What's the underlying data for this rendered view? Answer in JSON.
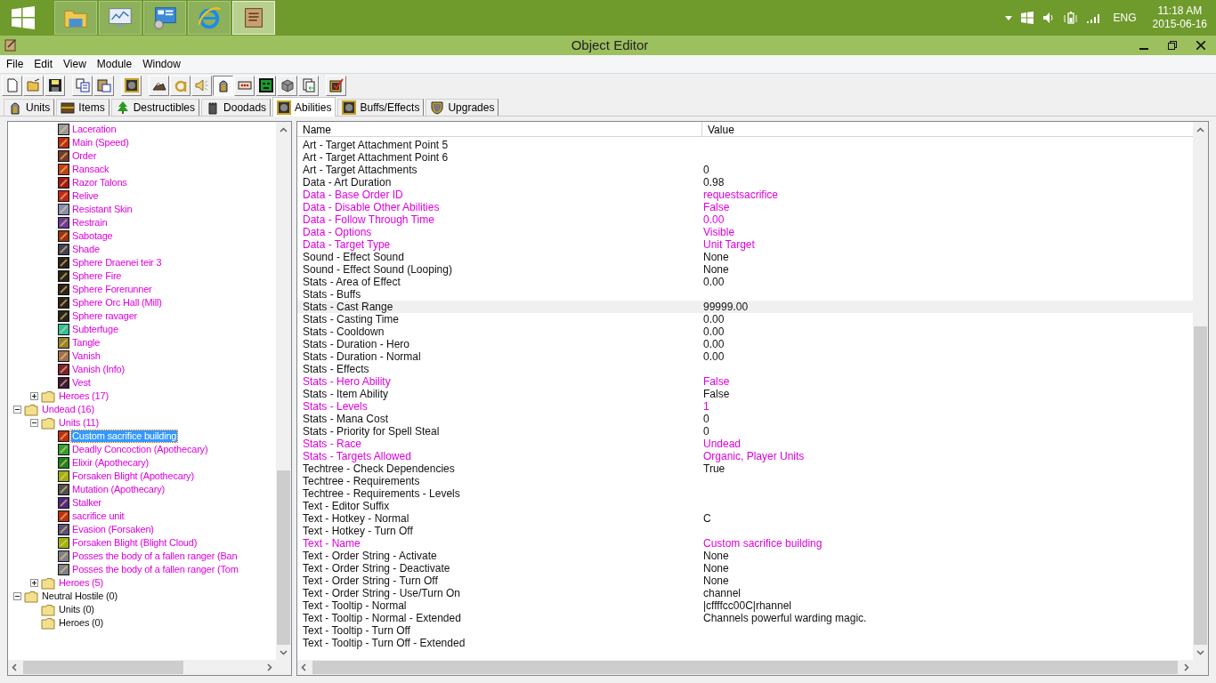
{
  "taskbar": {
    "apps": [
      {
        "kind": "folder",
        "selected": false
      },
      {
        "kind": "monitor",
        "selected": false
      },
      {
        "kind": "panel",
        "selected": false
      },
      {
        "kind": "browser",
        "selected": false
      },
      {
        "kind": "scroll",
        "selected": true
      }
    ],
    "language": "ENG",
    "time": "11:18 AM",
    "date": "2015-06-16"
  },
  "window": {
    "title": "Object Editor"
  },
  "menu": [
    "File",
    "Edit",
    "View",
    "Module",
    "Window"
  ],
  "toolbar": [
    {
      "kind": "new",
      "pressed": false
    },
    {
      "kind": "open",
      "pressed": false
    },
    {
      "kind": "save",
      "pressed": false
    },
    {
      "kind": "copy",
      "pressed": false
    },
    {
      "kind": "paste",
      "pressed": false
    },
    {
      "kind": "fist",
      "pressed": false
    },
    {
      "kind": "terrain",
      "pressed": false
    },
    {
      "kind": "letter",
      "pressed": false
    },
    {
      "kind": "sound",
      "pressed": false
    },
    {
      "kind": "helmet",
      "pressed": true
    },
    {
      "kind": "dice",
      "pressed": false
    },
    {
      "kind": "mask",
      "pressed": false
    },
    {
      "kind": "cube",
      "pressed": false
    },
    {
      "kind": "import",
      "pressed": false
    },
    {
      "kind": "check",
      "pressed": false
    }
  ],
  "tabs": [
    {
      "label": "Units",
      "kind": "helmet",
      "selected": false
    },
    {
      "label": "Items",
      "kind": "chest",
      "selected": false
    },
    {
      "label": "Destructibles",
      "kind": "tree",
      "selected": false
    },
    {
      "label": "Doodads",
      "kind": "tower",
      "selected": false
    },
    {
      "label": "Abilities",
      "kind": "fist",
      "selected": true
    },
    {
      "label": "Buffs/Effects",
      "kind": "fist",
      "selected": false
    },
    {
      "label": "Upgrades",
      "kind": "shield",
      "selected": false
    }
  ],
  "tree": [
    {
      "children": [
        {
          "children": [
            {
              "label": "Laceration",
              "color": "#9a9aa0",
              "modified": true,
              "selected": false
            },
            {
              "label": "Main (Speed)",
              "color": "#b83010",
              "modified": true,
              "selected": false
            },
            {
              "label": "Order",
              "color": "#7a3a28",
              "modified": true,
              "selected": false
            },
            {
              "label": "Ransack",
              "color": "#c04010",
              "modified": true,
              "selected": false
            },
            {
              "label": "Razor Talons",
              "color": "#a01818",
              "modified": true,
              "selected": false
            },
            {
              "label": "Relive",
              "color": "#c02818",
              "modified": true,
              "selected": false
            },
            {
              "label": "Resistant Skin",
              "color": "#8890b0",
              "modified": true,
              "selected": false
            },
            {
              "label": "Restrain",
              "color": "#6a3a98",
              "modified": true,
              "selected": false
            },
            {
              "label": "Sabotage",
              "color": "#a03010",
              "modified": true,
              "selected": false
            },
            {
              "label": "Shade",
              "color": "#404058",
              "modified": true,
              "selected": false
            },
            {
              "label": "Sphere Draenei teir 3",
              "color": "#2a2418",
              "modified": true,
              "selected": false
            },
            {
              "label": "Sphere Fire",
              "color": "#2a2418",
              "modified": true,
              "selected": false
            },
            {
              "label": "Sphere Forerunner",
              "color": "#2a2418",
              "modified": true,
              "selected": false
            },
            {
              "label": "Sphere Orc Hall (Mill)",
              "color": "#2a2418",
              "modified": true,
              "selected": false
            },
            {
              "label": "Sphere ravager",
              "color": "#2a2418",
              "modified": true,
              "selected": false
            },
            {
              "label": "Subterfuge",
              "color": "#30c0a0",
              "modified": true,
              "selected": false
            },
            {
              "label": "Tangle",
              "color": "#988028",
              "modified": true,
              "selected": false
            },
            {
              "label": "Vanish",
              "color": "#a07050",
              "modified": true,
              "selected": false
            },
            {
              "label": "Vanish (Info)",
              "color": "#802030",
              "modified": true,
              "selected": false
            },
            {
              "label": "Vest",
              "color": "#401838",
              "modified": true,
              "selected": false
            }
          ]
        },
        {
          "label": "Heroes (17)",
          "modified": true,
          "expanded": false,
          "selected": false
        }
      ]
    },
    {
      "label": "Undead (16)",
      "modified": true,
      "expanded": true,
      "selected": false,
      "children": [
        {
          "label": "Units (11)",
          "modified": true,
          "expanded": true,
          "selected": false,
          "children": [
            {
              "label": "Custom sacrifice building",
              "color": "#c03010",
              "modified": true,
              "selected": true
            },
            {
              "label": "Deadly Concoction (Apothecary)",
              "color": "#30a030",
              "modified": true,
              "selected": false
            },
            {
              "label": "Elixir (Apothecary)",
              "color": "#208020",
              "modified": true,
              "selected": false
            },
            {
              "label": "Forsaken Blight (Apothecary)",
              "color": "#a0b010",
              "modified": true,
              "selected": false
            },
            {
              "label": "Mutation (Apothecary)",
              "color": "#505050",
              "modified": true,
              "selected": false
            },
            {
              "label": "Stalker",
              "color": "#502880",
              "modified": true,
              "selected": false
            },
            {
              "label": "sacrifice unit",
              "color": "#c03010",
              "modified": true,
              "selected": false
            },
            {
              "label": "Evasion (Forsaken)",
              "color": "#5a5078",
              "modified": true,
              "selected": false
            },
            {
              "label": "Forsaken Blight  (Blight Cloud)",
              "color": "#a0b010",
              "modified": true,
              "selected": false
            },
            {
              "label": "Posses the body of a fallen ranger (Ban",
              "color": "#808088",
              "modified": true,
              "selected": false
            },
            {
              "label": "Posses the body of a fallen ranger (Tom",
              "color": "#808088",
              "modified": true,
              "selected": false
            }
          ]
        },
        {
          "label": "Heroes (5)",
          "modified": true,
          "expanded": false,
          "selected": false
        }
      ]
    },
    {
      "label": "Neutral Hostile (0)",
      "modified": false,
      "expanded": true,
      "selected": false,
      "children": [
        {
          "label": "Units (0)",
          "modified": false,
          "selected": false
        },
        {
          "label": "Heroes (0)",
          "modified": false,
          "selected": false
        }
      ]
    }
  ],
  "grid": {
    "columns": [
      "Name",
      "Value"
    ],
    "rows": [
      {
        "name": "Art - Target Attachment Point 5",
        "modified": false,
        "selected": false
      },
      {
        "name": "Art - Target Attachment Point 6",
        "modified": false,
        "selected": false
      },
      {
        "name": "Art - Target Attachments",
        "value": "0",
        "modified": false,
        "selected": false
      },
      {
        "name": "Data - Art Duration",
        "value": "0.98",
        "modified": false,
        "selected": false
      },
      {
        "name": "Data - Base Order ID",
        "value": "requestsacrifice",
        "modified": true,
        "selected": false
      },
      {
        "name": "Data - Disable Other Abilities",
        "value": "False",
        "modified": true,
        "selected": false
      },
      {
        "name": "Data - Follow Through Time",
        "value": "0.00",
        "modified": true,
        "selected": false
      },
      {
        "name": "Data - Options",
        "value": "Visible",
        "modified": true,
        "selected": false
      },
      {
        "name": "Data - Target Type",
        "value": "Unit Target",
        "modified": true,
        "selected": false
      },
      {
        "name": "Sound - Effect Sound",
        "value": "None",
        "modified": false,
        "selected": false
      },
      {
        "name": "Sound - Effect Sound (Looping)",
        "value": "None",
        "modified": false,
        "selected": false
      },
      {
        "name": "Stats - Area of Effect",
        "value": "0.00",
        "modified": false,
        "selected": false
      },
      {
        "name": "Stats - Buffs",
        "modified": false,
        "selected": false
      },
      {
        "name": "Stats - Cast Range",
        "value": "99999.00",
        "modified": false,
        "selected": true
      },
      {
        "name": "Stats - Casting Time",
        "value": "0.00",
        "modified": false,
        "selected": false
      },
      {
        "name": "Stats - Cooldown",
        "value": "0.00",
        "modified": false,
        "selected": false
      },
      {
        "name": "Stats - Duration - Hero",
        "value": "0.00",
        "modified": false,
        "selected": false
      },
      {
        "name": "Stats - Duration - Normal",
        "value": "0.00",
        "modified": false,
        "selected": false
      },
      {
        "name": "Stats - Effects",
        "modified": false,
        "selected": false
      },
      {
        "name": "Stats - Hero Ability",
        "value": "False",
        "modified": true,
        "selected": false
      },
      {
        "name": "Stats - Item Ability",
        "value": "False",
        "modified": false,
        "selected": false
      },
      {
        "name": "Stats - Levels",
        "value": "1",
        "modified": true,
        "selected": false
      },
      {
        "name": "Stats - Mana Cost",
        "value": "0",
        "modified": false,
        "selected": false
      },
      {
        "name": "Stats - Priority for Spell Steal",
        "value": "0",
        "modified": false,
        "selected": false
      },
      {
        "name": "Stats - Race",
        "value": "Undead",
        "modified": true,
        "selected": false
      },
      {
        "name": "Stats - Targets Allowed",
        "value": "Organic, Player Units",
        "modified": true,
        "selected": false
      },
      {
        "name": "Techtree - Check Dependencies",
        "value": "True",
        "modified": false,
        "selected": false
      },
      {
        "name": "Techtree - Requirements",
        "modified": false,
        "selected": false
      },
      {
        "name": "Techtree - Requirements - Levels",
        "modified": false,
        "selected": false
      },
      {
        "name": "Text - Editor Suffix",
        "modified": false,
        "selected": false
      },
      {
        "name": "Text - Hotkey - Normal",
        "value": "C",
        "modified": false,
        "selected": false
      },
      {
        "name": "Text - Hotkey - Turn Off",
        "modified": false,
        "selected": false
      },
      {
        "name": "Text - Name",
        "value": "Custom sacrifice building",
        "modified": true,
        "selected": false
      },
      {
        "name": "Text - Order String - Activate",
        "value": "None",
        "modified": false,
        "selected": false
      },
      {
        "name": "Text - Order String - Deactivate",
        "value": "None",
        "modified": false,
        "selected": false
      },
      {
        "name": "Text - Order String - Turn Off",
        "value": "None",
        "modified": false,
        "selected": false
      },
      {
        "name": "Text - Order String - Use/Turn On",
        "value": "channel",
        "modified": false,
        "selected": false
      },
      {
        "name": "Text - Tooltip - Normal",
        "value": "|cffffcc00C|rhannel",
        "modified": false,
        "selected": false
      },
      {
        "name": "Text - Tooltip - Normal - Extended",
        "value": "Channels powerful warding magic.",
        "modified": false,
        "selected": false
      },
      {
        "name": "Text - Tooltip - Turn Off",
        "modified": false,
        "selected": false
      },
      {
        "name": "Text - Tooltip - Turn Off - Extended",
        "modified": false,
        "selected": false
      }
    ]
  }
}
